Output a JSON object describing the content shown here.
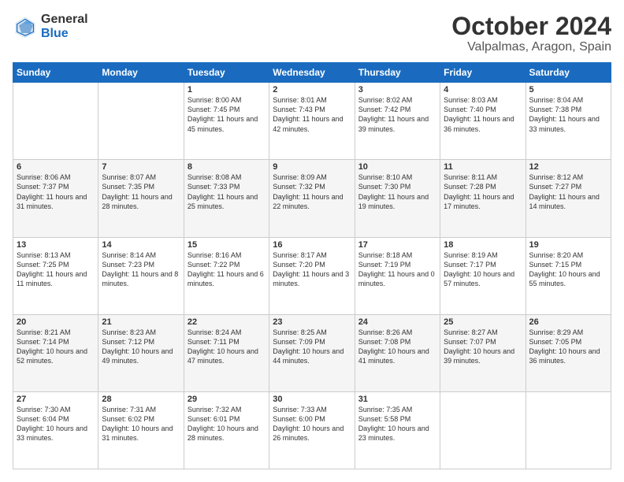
{
  "logo": {
    "general": "General",
    "blue": "Blue"
  },
  "title": "October 2024",
  "subtitle": "Valpalmas, Aragon, Spain",
  "headers": [
    "Sunday",
    "Monday",
    "Tuesday",
    "Wednesday",
    "Thursday",
    "Friday",
    "Saturday"
  ],
  "weeks": [
    [
      {
        "day": "",
        "info": ""
      },
      {
        "day": "",
        "info": ""
      },
      {
        "day": "1",
        "info": "Sunrise: 8:00 AM\nSunset: 7:45 PM\nDaylight: 11 hours and 45 minutes."
      },
      {
        "day": "2",
        "info": "Sunrise: 8:01 AM\nSunset: 7:43 PM\nDaylight: 11 hours and 42 minutes."
      },
      {
        "day": "3",
        "info": "Sunrise: 8:02 AM\nSunset: 7:42 PM\nDaylight: 11 hours and 39 minutes."
      },
      {
        "day": "4",
        "info": "Sunrise: 8:03 AM\nSunset: 7:40 PM\nDaylight: 11 hours and 36 minutes."
      },
      {
        "day": "5",
        "info": "Sunrise: 8:04 AM\nSunset: 7:38 PM\nDaylight: 11 hours and 33 minutes."
      }
    ],
    [
      {
        "day": "6",
        "info": "Sunrise: 8:06 AM\nSunset: 7:37 PM\nDaylight: 11 hours and 31 minutes."
      },
      {
        "day": "7",
        "info": "Sunrise: 8:07 AM\nSunset: 7:35 PM\nDaylight: 11 hours and 28 minutes."
      },
      {
        "day": "8",
        "info": "Sunrise: 8:08 AM\nSunset: 7:33 PM\nDaylight: 11 hours and 25 minutes."
      },
      {
        "day": "9",
        "info": "Sunrise: 8:09 AM\nSunset: 7:32 PM\nDaylight: 11 hours and 22 minutes."
      },
      {
        "day": "10",
        "info": "Sunrise: 8:10 AM\nSunset: 7:30 PM\nDaylight: 11 hours and 19 minutes."
      },
      {
        "day": "11",
        "info": "Sunrise: 8:11 AM\nSunset: 7:28 PM\nDaylight: 11 hours and 17 minutes."
      },
      {
        "day": "12",
        "info": "Sunrise: 8:12 AM\nSunset: 7:27 PM\nDaylight: 11 hours and 14 minutes."
      }
    ],
    [
      {
        "day": "13",
        "info": "Sunrise: 8:13 AM\nSunset: 7:25 PM\nDaylight: 11 hours and 11 minutes."
      },
      {
        "day": "14",
        "info": "Sunrise: 8:14 AM\nSunset: 7:23 PM\nDaylight: 11 hours and 8 minutes."
      },
      {
        "day": "15",
        "info": "Sunrise: 8:16 AM\nSunset: 7:22 PM\nDaylight: 11 hours and 6 minutes."
      },
      {
        "day": "16",
        "info": "Sunrise: 8:17 AM\nSunset: 7:20 PM\nDaylight: 11 hours and 3 minutes."
      },
      {
        "day": "17",
        "info": "Sunrise: 8:18 AM\nSunset: 7:19 PM\nDaylight: 11 hours and 0 minutes."
      },
      {
        "day": "18",
        "info": "Sunrise: 8:19 AM\nSunset: 7:17 PM\nDaylight: 10 hours and 57 minutes."
      },
      {
        "day": "19",
        "info": "Sunrise: 8:20 AM\nSunset: 7:15 PM\nDaylight: 10 hours and 55 minutes."
      }
    ],
    [
      {
        "day": "20",
        "info": "Sunrise: 8:21 AM\nSunset: 7:14 PM\nDaylight: 10 hours and 52 minutes."
      },
      {
        "day": "21",
        "info": "Sunrise: 8:23 AM\nSunset: 7:12 PM\nDaylight: 10 hours and 49 minutes."
      },
      {
        "day": "22",
        "info": "Sunrise: 8:24 AM\nSunset: 7:11 PM\nDaylight: 10 hours and 47 minutes."
      },
      {
        "day": "23",
        "info": "Sunrise: 8:25 AM\nSunset: 7:09 PM\nDaylight: 10 hours and 44 minutes."
      },
      {
        "day": "24",
        "info": "Sunrise: 8:26 AM\nSunset: 7:08 PM\nDaylight: 10 hours and 41 minutes."
      },
      {
        "day": "25",
        "info": "Sunrise: 8:27 AM\nSunset: 7:07 PM\nDaylight: 10 hours and 39 minutes."
      },
      {
        "day": "26",
        "info": "Sunrise: 8:29 AM\nSunset: 7:05 PM\nDaylight: 10 hours and 36 minutes."
      }
    ],
    [
      {
        "day": "27",
        "info": "Sunrise: 7:30 AM\nSunset: 6:04 PM\nDaylight: 10 hours and 33 minutes."
      },
      {
        "day": "28",
        "info": "Sunrise: 7:31 AM\nSunset: 6:02 PM\nDaylight: 10 hours and 31 minutes."
      },
      {
        "day": "29",
        "info": "Sunrise: 7:32 AM\nSunset: 6:01 PM\nDaylight: 10 hours and 28 minutes."
      },
      {
        "day": "30",
        "info": "Sunrise: 7:33 AM\nSunset: 6:00 PM\nDaylight: 10 hours and 26 minutes."
      },
      {
        "day": "31",
        "info": "Sunrise: 7:35 AM\nSunset: 5:58 PM\nDaylight: 10 hours and 23 minutes."
      },
      {
        "day": "",
        "info": ""
      },
      {
        "day": "",
        "info": ""
      }
    ]
  ]
}
